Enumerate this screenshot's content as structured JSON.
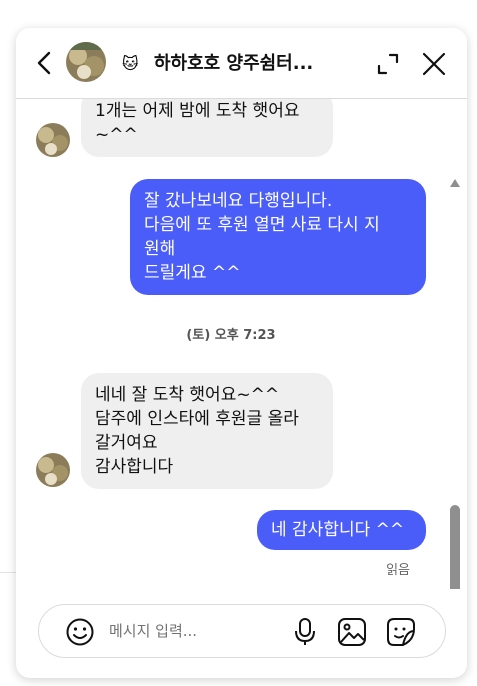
{
  "header": {
    "title": "하하호호 양주쉼터...",
    "emoji": "🐱"
  },
  "messages": [
    {
      "side": "in",
      "text": "1개는 어제 밤에 도착 햇어요\n~^^"
    },
    {
      "side": "out",
      "text": "잘 갔나보네요 다행입니다.\n다음에 또 후원 열면 사료 다시 지\n원해\n드릴게요 ^^"
    },
    {
      "side": "in",
      "text": "네네 잘 도착 햇어요~^^\n담주에 인스타에 후원글 올라\n갈거여요\n감사합니다"
    },
    {
      "side": "out",
      "text": "네 감사합니다 ^^"
    }
  ],
  "timestamp": "(토) 오후 7:23",
  "read_status": "읽음",
  "composer": {
    "placeholder": "메시지 입력..."
  },
  "colors": {
    "outgoing_bubble": "#4a5df9",
    "incoming_bubble": "#efefef"
  },
  "icons": [
    "back-arrow-icon",
    "expand-icon",
    "close-icon",
    "smile-icon",
    "microphone-icon",
    "photo-icon",
    "sticker-icon"
  ]
}
